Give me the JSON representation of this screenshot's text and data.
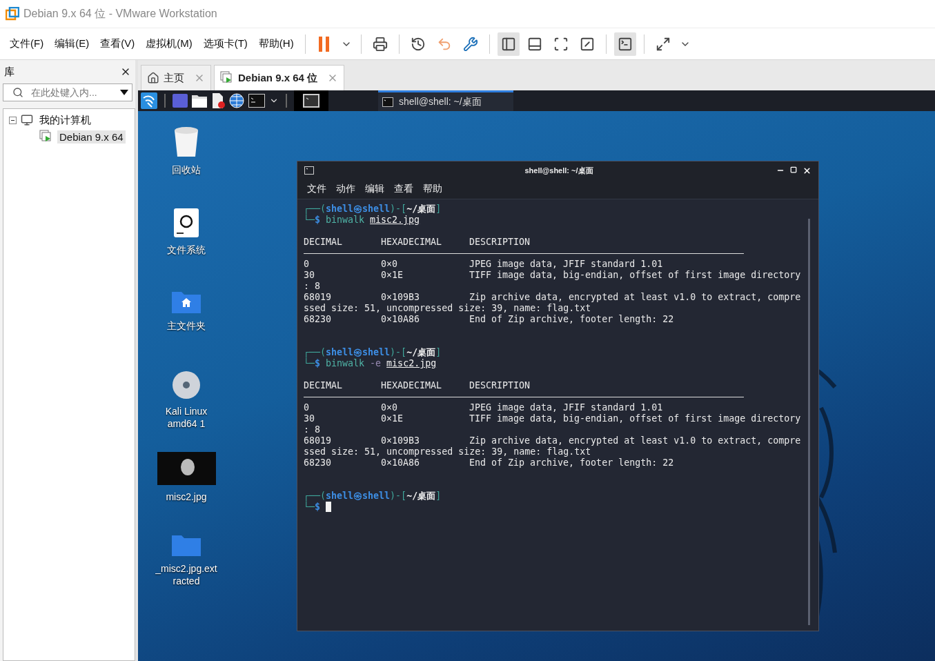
{
  "window": {
    "title": "Debian 9.x 64 位 - VMware Workstation"
  },
  "menu": [
    "文件(F)",
    "编辑(E)",
    "查看(V)",
    "虚拟机(M)",
    "选项卡(T)",
    "帮助(H)"
  ],
  "library": {
    "title": "库",
    "search": {
      "placeholder": "在此处键入内..."
    },
    "tree": [
      {
        "label": "我的计算机",
        "expanded": true,
        "children": [
          {
            "label": "Debian 9.x 64",
            "selected": true
          }
        ]
      }
    ]
  },
  "tabs": [
    {
      "label": "主页",
      "kind": "home",
      "selected": false
    },
    {
      "label": "Debian 9.x 64 位",
      "kind": "vm",
      "selected": true
    }
  ],
  "guest": {
    "taskbar": {
      "window_button": "shell@shell: ~/桌面"
    },
    "desktop_icons": [
      {
        "label": "回收站",
        "kind": "trash"
      },
      {
        "label": "文件系统",
        "kind": "drive"
      },
      {
        "label": "主文件夹",
        "kind": "home"
      },
      {
        "label": "Kali Linux amd64 1",
        "kind": "disc"
      },
      {
        "label": "misc2.jpg",
        "kind": "image"
      },
      {
        "label": "_misc2.jpg.extracted",
        "kind": "folder"
      }
    ],
    "terminal": {
      "title": "shell@shell: ~/桌面",
      "menu": [
        "文件",
        "动作",
        "编辑",
        "查看",
        "帮助"
      ],
      "lines": [
        {
          "kind": "segments",
          "parts": [
            {
              "text": "┌──(",
              "kind": "frame"
            },
            {
              "text": "shell㉿shell",
              "kind": "user"
            },
            {
              "text": ")-[",
              "kind": "frame"
            },
            {
              "text": "~/桌面",
              "kind": "path"
            },
            {
              "text": "]",
              "kind": "frame"
            }
          ]
        },
        {
          "kind": "segments",
          "parts": [
            {
              "text": "└─",
              "kind": "frame"
            },
            {
              "text": "$ ",
              "kind": "dollar"
            },
            {
              "text": "binwalk ",
              "kind": "cmd"
            },
            {
              "text": "misc2.jpg",
              "kind": "file"
            }
          ]
        },
        {
          "kind": "blank"
        },
        {
          "kind": "row",
          "cells": [
            "DECIMAL",
            "HEXADECIMAL",
            "DESCRIPTION"
          ]
        },
        {
          "kind": "rule"
        },
        {
          "kind": "row",
          "cells": [
            "0",
            "0×0",
            "JPEG image data, JFIF standard 1.01"
          ]
        },
        {
          "kind": "row",
          "cells": [
            "30",
            "0×1E",
            "TIFF image data, big-endian, offset of first image directory"
          ]
        },
        {
          "kind": "text",
          "text": ": 8"
        },
        {
          "kind": "row",
          "cells": [
            "68019",
            "0×109B3",
            "Zip archive data, encrypted at least v1.0 to extract, compre"
          ]
        },
        {
          "kind": "text",
          "text": "ssed size: 51, uncompressed size: 39, name: flag.txt"
        },
        {
          "kind": "row",
          "cells": [
            "68230",
            "0×10A86",
            "End of Zip archive, footer length: 22"
          ]
        },
        {
          "kind": "blank"
        },
        {
          "kind": "blank"
        },
        {
          "kind": "segments",
          "parts": [
            {
              "text": "┌──(",
              "kind": "frame"
            },
            {
              "text": "shell㉿shell",
              "kind": "user"
            },
            {
              "text": ")-[",
              "kind": "frame"
            },
            {
              "text": "~/桌面",
              "kind": "path"
            },
            {
              "text": "]",
              "kind": "frame"
            }
          ]
        },
        {
          "kind": "segments",
          "parts": [
            {
              "text": "└─",
              "kind": "frame"
            },
            {
              "text": "$ ",
              "kind": "dollar"
            },
            {
              "text": "binwalk ",
              "kind": "cmd"
            },
            {
              "text": "-e ",
              "kind": "option"
            },
            {
              "text": "misc2.jpg",
              "kind": "file"
            }
          ]
        },
        {
          "kind": "blank"
        },
        {
          "kind": "row",
          "cells": [
            "DECIMAL",
            "HEXADECIMAL",
            "DESCRIPTION"
          ]
        },
        {
          "kind": "rule"
        },
        {
          "kind": "row",
          "cells": [
            "0",
            "0×0",
            "JPEG image data, JFIF standard 1.01"
          ]
        },
        {
          "kind": "row",
          "cells": [
            "30",
            "0×1E",
            "TIFF image data, big-endian, offset of first image directory"
          ]
        },
        {
          "kind": "text",
          "text": ": 8"
        },
        {
          "kind": "row",
          "cells": [
            "68019",
            "0×109B3",
            "Zip archive data, encrypted at least v1.0 to extract, compre"
          ]
        },
        {
          "kind": "text",
          "text": "ssed size: 51, uncompressed size: 39, name: flag.txt"
        },
        {
          "kind": "row",
          "cells": [
            "68230",
            "0×10A86",
            "End of Zip archive, footer length: 22"
          ]
        },
        {
          "kind": "blank"
        },
        {
          "kind": "blank"
        },
        {
          "kind": "segments",
          "parts": [
            {
              "text": "┌──(",
              "kind": "frame"
            },
            {
              "text": "shell㉿shell",
              "kind": "user"
            },
            {
              "text": ")-[",
              "kind": "frame"
            },
            {
              "text": "~/桌面",
              "kind": "path"
            },
            {
              "text": "]",
              "kind": "frame"
            }
          ]
        },
        {
          "kind": "segments",
          "parts": [
            {
              "text": "└─",
              "kind": "frame"
            },
            {
              "text": "$ ",
              "kind": "dollar"
            },
            {
              "kind": "cursor"
            }
          ]
        }
      ]
    }
  }
}
